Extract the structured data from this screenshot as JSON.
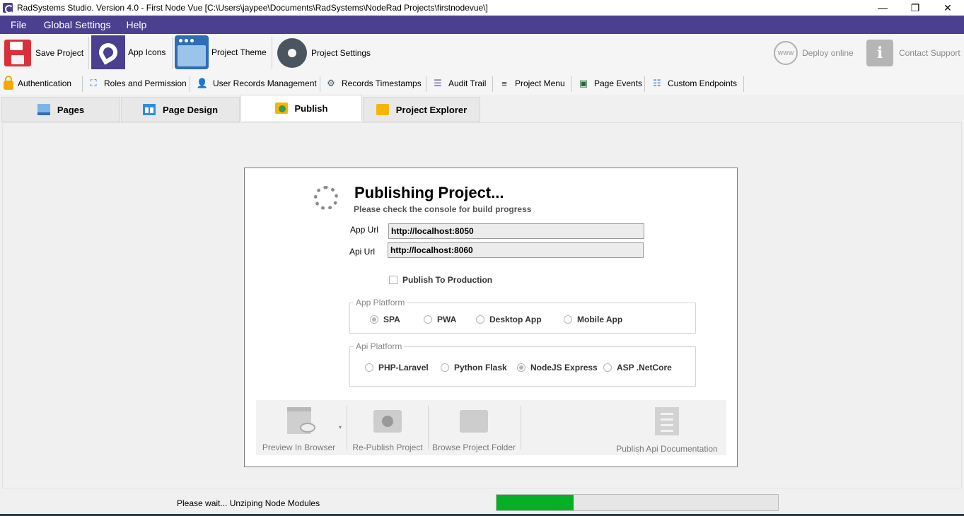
{
  "window": {
    "title": "RadSystems Studio.  Version 4.0 - First Node Vue [C:\\Users\\jaypee\\Documents\\RadSystems\\NodeRad Projects\\firstnodevue\\]",
    "minimize": "—",
    "maximize": "❐",
    "close": "✕"
  },
  "menu": {
    "items": [
      "File",
      "Global Settings",
      "Help"
    ]
  },
  "toolbar": {
    "save_project": "Save Project",
    "app_icons": "App Icons",
    "project_theme": "Project Theme",
    "project_settings": "Project Settings",
    "deploy_online": "Deploy online",
    "contact_support": "Contact Support",
    "www_icon_text": "WWW",
    "info_icon_text": "i"
  },
  "toolbar2": {
    "items": [
      "Authentication",
      "Roles and Permission",
      "User Records Management",
      "Records Timestamps",
      "Audit Trail",
      "Project Menu",
      "Page Events",
      "Custom Endpoints"
    ]
  },
  "tabs": [
    {
      "label": "Pages"
    },
    {
      "label": "Page Design"
    },
    {
      "label": "Publish",
      "active": true
    },
    {
      "label": "Project Explorer"
    }
  ],
  "publish": {
    "title": "Publishing Project...",
    "subtitle": "Please check the console for build progress",
    "app_url_label": "App Url",
    "app_url_value": "http://localhost:8050",
    "api_url_label": "Api Url",
    "api_url_value": "http://localhost:8060",
    "publish_to_production": "Publish To Production",
    "publish_to_production_checked": false,
    "app_platform": {
      "legend": "App Platform",
      "options": [
        "SPA",
        "PWA",
        "Desktop App",
        "Mobile App"
      ],
      "selected": "SPA"
    },
    "api_platform": {
      "legend": "Api Platform",
      "options": [
        "PHP-Laravel",
        "Python Flask",
        "NodeJS Express",
        "ASP .NetCore"
      ],
      "selected": "NodeJS Express"
    },
    "actions": {
      "preview_in_browser": "Preview In Browser",
      "republish_project": "Re-Publish Project",
      "browse_project_folder": "Browse Project Folder",
      "publish_api_documentation": "Publish Api Documentation",
      "dropdown_arrow": "▾"
    }
  },
  "status": {
    "text": "Please wait... Unziping Node Modules",
    "progress_fraction": 0.275,
    "progress_color": "#06b025"
  },
  "colors": {
    "accent": "#4b3f8f"
  }
}
